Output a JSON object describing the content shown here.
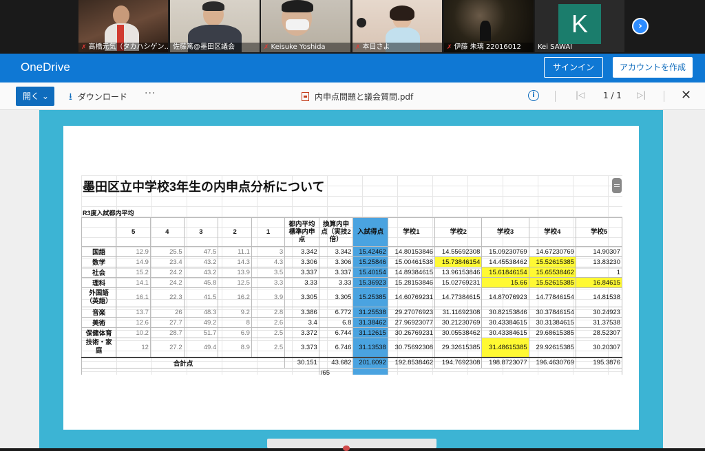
{
  "participants": [
    {
      "name": "高橋元気（タカハシゲン...",
      "muted": true
    },
    {
      "name": "佐藤篤@墨田区議会",
      "muted": false
    },
    {
      "name": "Keisuke Yoshida",
      "muted": true
    },
    {
      "name": "本目さよ",
      "muted": true
    },
    {
      "name": "伊藤 朱璃 22016012",
      "muted": true
    },
    {
      "name": "Kei SAWAI",
      "muted": false,
      "initial": "K"
    }
  ],
  "onedrive": {
    "logo": "OneDrive",
    "signin": "サインイン",
    "create_account": "アカウントを作成"
  },
  "toolbar": {
    "open": "開く ⌄",
    "download": "ダウンロード",
    "more": "···",
    "file_name": "内申点問題と議会質問.pdf",
    "page_indicator": "1 / 1",
    "close": "✕"
  },
  "sheet": {
    "title": "墨田区立中学校3年生の内申点分析について",
    "subtitle": "R3度入試都内平均",
    "headers": [
      "",
      "5",
      "4",
      "3",
      "2",
      "1",
      "都内平均標準内申点",
      "換算内申点（実技2倍）",
      "入試得点",
      "学校1",
      "学校2",
      "学校3",
      "学校4",
      "学校5"
    ],
    "rows": [
      {
        "subject": "国語",
        "v5": "12.9",
        "v4": "25.5",
        "v3": "47.5",
        "v2": "11.1",
        "v1": "3",
        "std": "3.342",
        "conv": "3.342",
        "score": "15.42462",
        "s1": "14.80153846",
        "s2": "14.55692308",
        "s3": "15.09230769",
        "s4": "14.67230769",
        "s5": "14.90307"
      },
      {
        "subject": "数学",
        "v5": "14.9",
        "v4": "23.4",
        "v3": "43.2",
        "v2": "14.3",
        "v1": "4.3",
        "std": "3.306",
        "conv": "3.306",
        "score": "15.25846",
        "s1": "15.00461538",
        "s2": "15.73846154",
        "s3": "14.45538462",
        "s4": "15.52615385",
        "s5": "13.83230"
      },
      {
        "subject": "社会",
        "v5": "15.2",
        "v4": "24.2",
        "v3": "43.2",
        "v2": "13.9",
        "v1": "3.5",
        "std": "3.337",
        "conv": "3.337",
        "score": "15.40154",
        "s1": "14.89384615",
        "s2": "13.96153846",
        "s3": "15.61846154",
        "s4": "15.65538462",
        "s5": "1"
      },
      {
        "subject": "理科",
        "v5": "14.1",
        "v4": "24.2",
        "v3": "45.8",
        "v2": "12.5",
        "v1": "3.3",
        "std": "3.33",
        "conv": "3.33",
        "score": "15.36923",
        "s1": "15.28153846",
        "s2": "15.02769231",
        "s3": "15.66",
        "s4": "15.52615385",
        "s5": "16.84615"
      },
      {
        "subject": "外国語（英語）",
        "v5": "16.1",
        "v4": "22.3",
        "v3": "41.5",
        "v2": "16.2",
        "v1": "3.9",
        "std": "3.305",
        "conv": "3.305",
        "score": "15.25385",
        "s1": "14.60769231",
        "s2": "14.77384615",
        "s3": "14.87076923",
        "s4": "14.77846154",
        "s5": "14.81538"
      },
      {
        "subject": "音楽",
        "v5": "13.7",
        "v4": "26",
        "v3": "48.3",
        "v2": "9.2",
        "v1": "2.8",
        "std": "3.386",
        "conv": "6.772",
        "score": "31.25538",
        "s1": "29.27076923",
        "s2": "31.11692308",
        "s3": "30.82153846",
        "s4": "30.37846154",
        "s5": "30.24923"
      },
      {
        "subject": "美術",
        "v5": "12.6",
        "v4": "27.7",
        "v3": "49.2",
        "v2": "8",
        "v1": "2.6",
        "std": "3.4",
        "conv": "6.8",
        "score": "31.38462",
        "s1": "27.96923077",
        "s2": "30.21230769",
        "s3": "30.43384615",
        "s4": "30.31384615",
        "s5": "31.37538"
      },
      {
        "subject": "保健体育",
        "v5": "10.2",
        "v4": "28.7",
        "v3": "51.7",
        "v2": "6.9",
        "v1": "2.5",
        "std": "3.372",
        "conv": "6.744",
        "score": "31.12615",
        "s1": "30.26769231",
        "s2": "30.05538462",
        "s3": "30.43384615",
        "s4": "29.68615385",
        "s5": "28.52307"
      },
      {
        "subject": "技術・家庭",
        "v5": "12",
        "v4": "27.2",
        "v3": "49.4",
        "v2": "8.9",
        "v1": "2.5",
        "std": "3.373",
        "conv": "6.746",
        "score": "31.13538",
        "s1": "30.75692308",
        "s2": "29.32615385",
        "s3": "31.48615385",
        "s4": "29.92615385",
        "s5": "30.20307"
      }
    ],
    "total": {
      "label": "合計点",
      "std": "30.151",
      "conv": "43.682",
      "score": "201.6092",
      "s1": "192.8538462",
      "s2": "194.7692308",
      "s3": "198.8723077",
      "s4": "196.4630769",
      "s5": "195.3876"
    },
    "footer_note": "/65"
  },
  "colors": {
    "onedrive_blue": "#0f78d4",
    "frame_cyan": "#3cb4d4",
    "score_blue": "#4aa3e0",
    "highlight_yellow": "#fff933"
  }
}
